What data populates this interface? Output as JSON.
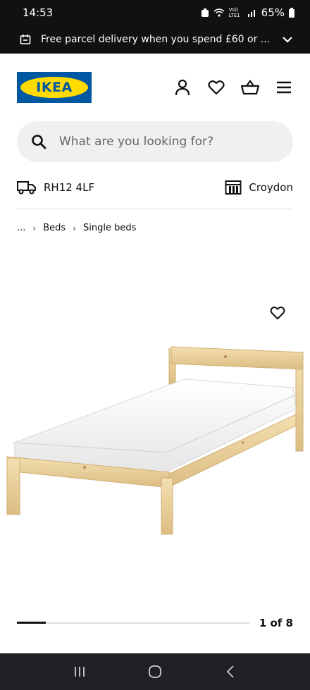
{
  "status_bar": {
    "time": "14:53",
    "network_label": "Vo)) LTE1",
    "battery": "65%"
  },
  "promo": {
    "text": "Free parcel delivery when you spend £60 or ...",
    "icon": "calendar-icon"
  },
  "header": {
    "logo_text": "IKEA",
    "actions": [
      "account-icon",
      "heart-icon",
      "basket-icon",
      "menu-icon"
    ]
  },
  "search": {
    "placeholder": "What are you looking for?"
  },
  "location": {
    "postcode": "RH12 4LF",
    "store": "Croydon"
  },
  "breadcrumb": {
    "ellipsis": "...",
    "items": [
      "Beds",
      "Single beds"
    ]
  },
  "product": {
    "image_counter": "1 of 8",
    "current_image": 1,
    "total_images": 8
  },
  "colors": {
    "brand_blue": "#0058a3",
    "brand_yellow": "#ffdb00",
    "search_bg": "#f0f0f0"
  }
}
